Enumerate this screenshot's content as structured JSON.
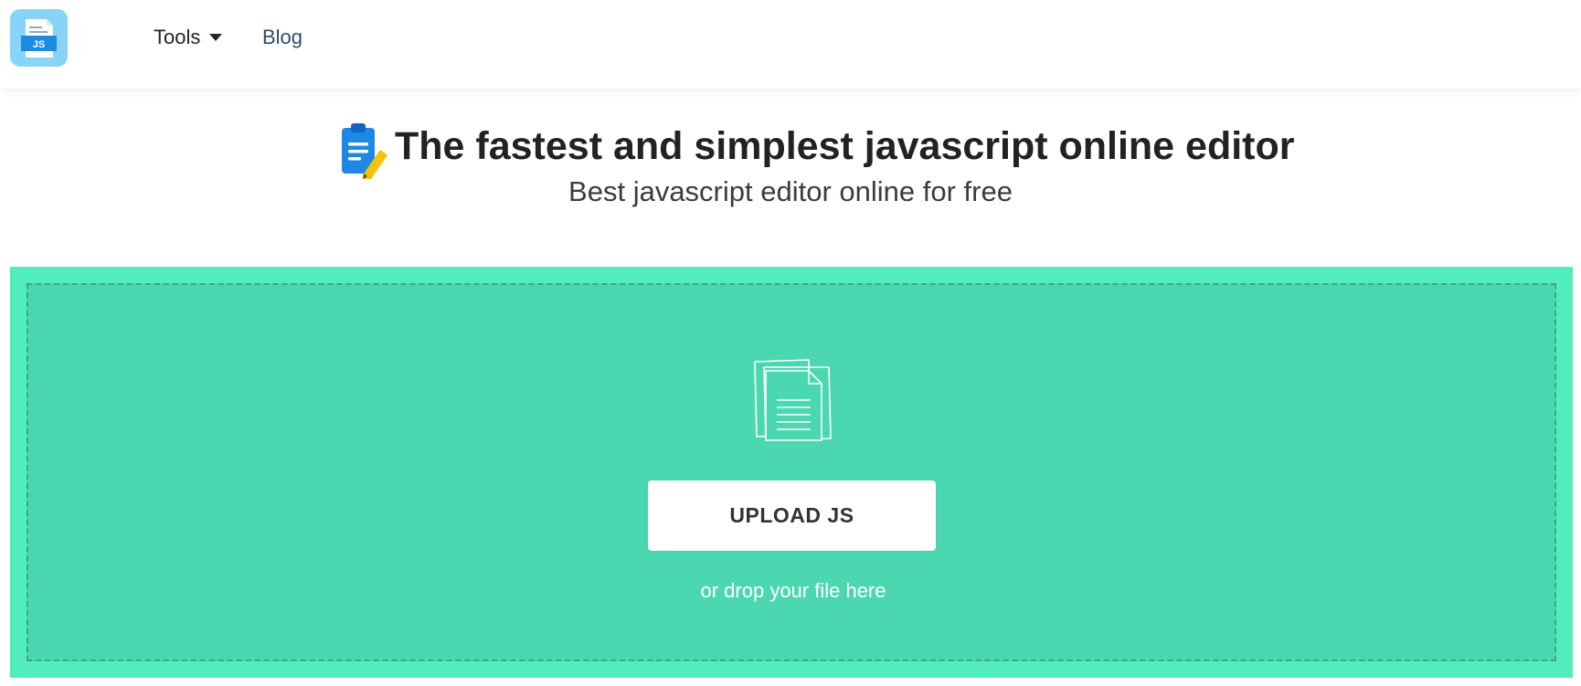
{
  "navbar": {
    "logo_text": "JS",
    "items": [
      {
        "label": "Tools",
        "has_dropdown": true
      },
      {
        "label": "Blog"
      }
    ]
  },
  "hero": {
    "title": "The fastest and simplest javascript online editor",
    "subtitle": "Best javascript editor online for free",
    "icon": "clipboard-pencil-icon"
  },
  "upload": {
    "icon": "files-icon",
    "button_label": "UPLOAD JS",
    "hint": "or drop your file here"
  },
  "colors": {
    "upload_outer": "#52edbf",
    "upload_inner": "#4bd7b0",
    "logo_background": "#87d4f8",
    "logo_badge": "#1d8ce0",
    "clipboard": "#1e88e5",
    "pencil": "#f4c20d"
  }
}
